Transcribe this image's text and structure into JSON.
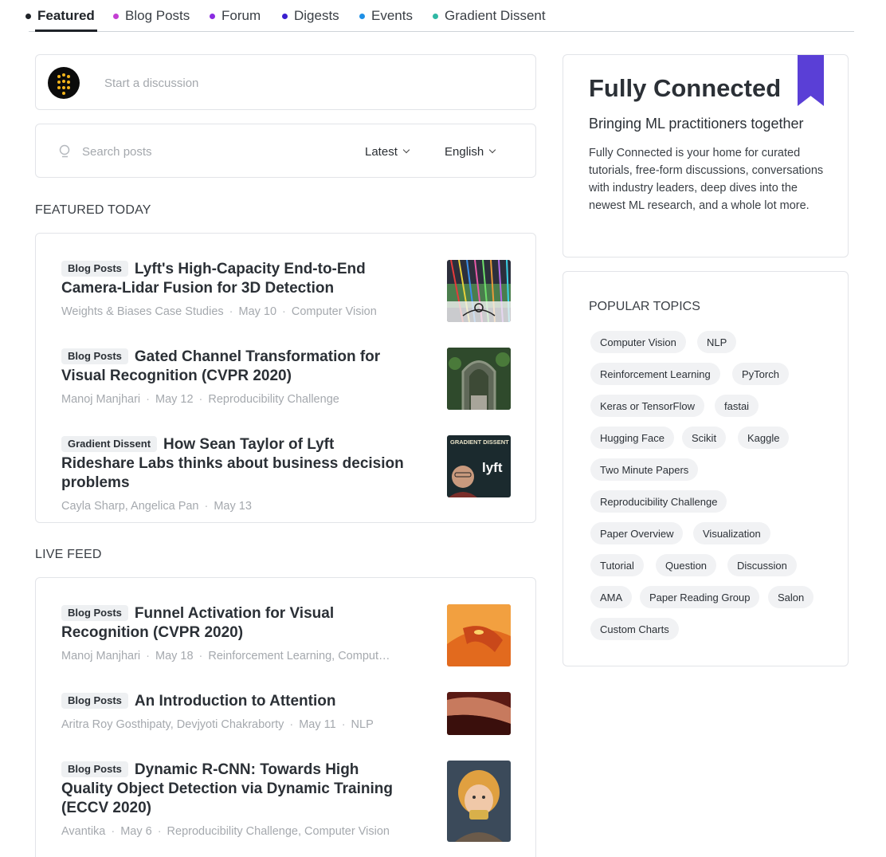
{
  "tabs": [
    {
      "label": "Featured",
      "color": "#1f2328"
    },
    {
      "label": "Blog Posts",
      "color": "#c43fd3"
    },
    {
      "label": "Forum",
      "color": "#8a2be2"
    },
    {
      "label": "Digests",
      "color": "#3a1fcf"
    },
    {
      "label": "Events",
      "color": "#1e90e6"
    },
    {
      "label": "Gradient Dissent",
      "color": "#2fb8a4"
    }
  ],
  "discussion": {
    "placeholder": "Start a discussion"
  },
  "search": {
    "placeholder": "Search posts",
    "sort": "Latest",
    "language": "English"
  },
  "featured_today": {
    "title": "FEATURED TODAY",
    "posts": [
      {
        "badge": "Blog Posts",
        "title": "Lyft's High-Capacity End-to-End Camera-Lidar Fusion for 3D Detection",
        "meta": [
          "Weights & Biases Case Studies",
          "May 10",
          "Computer Vision"
        ]
      },
      {
        "badge": "Blog Posts",
        "title": "Gated Channel Transformation for Visual Recognition (CVPR 2020)",
        "meta": [
          "Manoj Manjhari",
          "May 12",
          "Reproducibility Challenge"
        ]
      },
      {
        "badge": "Gradient Dissent",
        "title": "How Sean Taylor of Lyft Rideshare Labs thinks about business decision problems",
        "meta": [
          "Cayla Sharp, Angelica Pan",
          "May 13"
        ],
        "thumb_text": {
          "top": "GRADIENT DISSENT",
          "brand": "lyft"
        }
      }
    ]
  },
  "live_feed": {
    "title": "LIVE FEED",
    "posts": [
      {
        "badge": "Blog Posts",
        "title": "Funnel Activation for Visual Recognition (CVPR 2020)",
        "meta": [
          "Manoj Manjhari",
          "May 18",
          "Reinforcement Learning, Comput…"
        ]
      },
      {
        "badge": "Blog Posts",
        "title": "An Introduction to Attention",
        "meta": [
          "Aritra Roy Gosthipaty, Devjyoti Chakraborty",
          "May 11",
          "NLP"
        ]
      },
      {
        "badge": "Blog Posts",
        "title": "Dynamic R-CNN: Towards High Quality Object Detection via Dynamic Training (ECCV 2020)",
        "meta": [
          "Avantika",
          "May 6",
          "Reproducibility Challenge, Computer Vision"
        ]
      }
    ]
  },
  "sidebar": {
    "title": "Fully Connected",
    "subtitle": "Bringing ML practitioners together",
    "description": "Fully Connected is your home for curated tutorials, free-form discussions, conversations with industry leaders, deep dives into the newest ML research, and a whole lot more.",
    "ribbon_color": "#5a3fd6"
  },
  "topics": {
    "title": "POPULAR TOPICS",
    "items": [
      "Computer Vision",
      "NLP",
      "Reinforcement Learning",
      "PyTorch",
      "Keras or TensorFlow",
      "fastai",
      "Hugging Face",
      "Scikit",
      "Kaggle",
      "Two Minute Papers",
      "Reproducibility Challenge",
      "Paper Overview",
      "Visualization",
      "Tutorial",
      "Question",
      "Discussion",
      "AMA",
      "Paper Reading Group",
      "Salon",
      "Custom Charts"
    ]
  }
}
